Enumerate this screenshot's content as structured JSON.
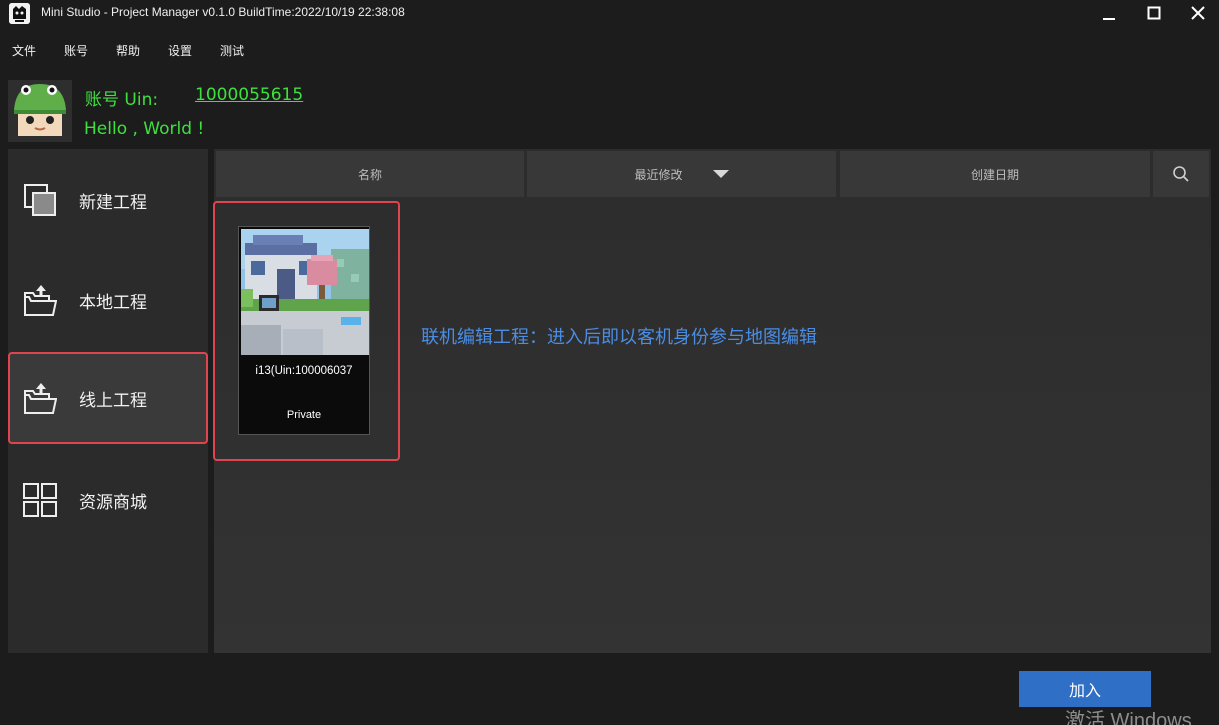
{
  "window": {
    "title": "Mini Studio - Project Manager v0.1.0 BuildTime:2022/10/19 22:38:08"
  },
  "menu": [
    "文件",
    "账号",
    "帮助",
    "设置",
    "测试"
  ],
  "account": {
    "label": "账号 Uin:",
    "uin": "1000055615",
    "greeting": "Hello , World !"
  },
  "sidebar": {
    "items": [
      {
        "label": "新建工程",
        "icon": "new-project-icon"
      },
      {
        "label": "本地工程",
        "icon": "folder-upload-icon"
      },
      {
        "label": "线上工程",
        "icon": "folder-upload-icon",
        "active": true
      },
      {
        "label": "资源商城",
        "icon": "grid-icon"
      }
    ]
  },
  "columns": {
    "name": "名称",
    "modified": "最近修改",
    "created": "创建日期"
  },
  "project": {
    "name": "i13(Uin:100006037",
    "visibility": "Private"
  },
  "hint": "联机编辑工程：进入后即以客机身份参与地图编辑",
  "actions": {
    "join": "加入"
  },
  "watermark": "激活 Windows",
  "colors": {
    "accent_green": "#3ee03e",
    "highlight_red": "#e0454f",
    "hint_blue": "#4a8de4",
    "button_blue": "#2f6fc6"
  }
}
